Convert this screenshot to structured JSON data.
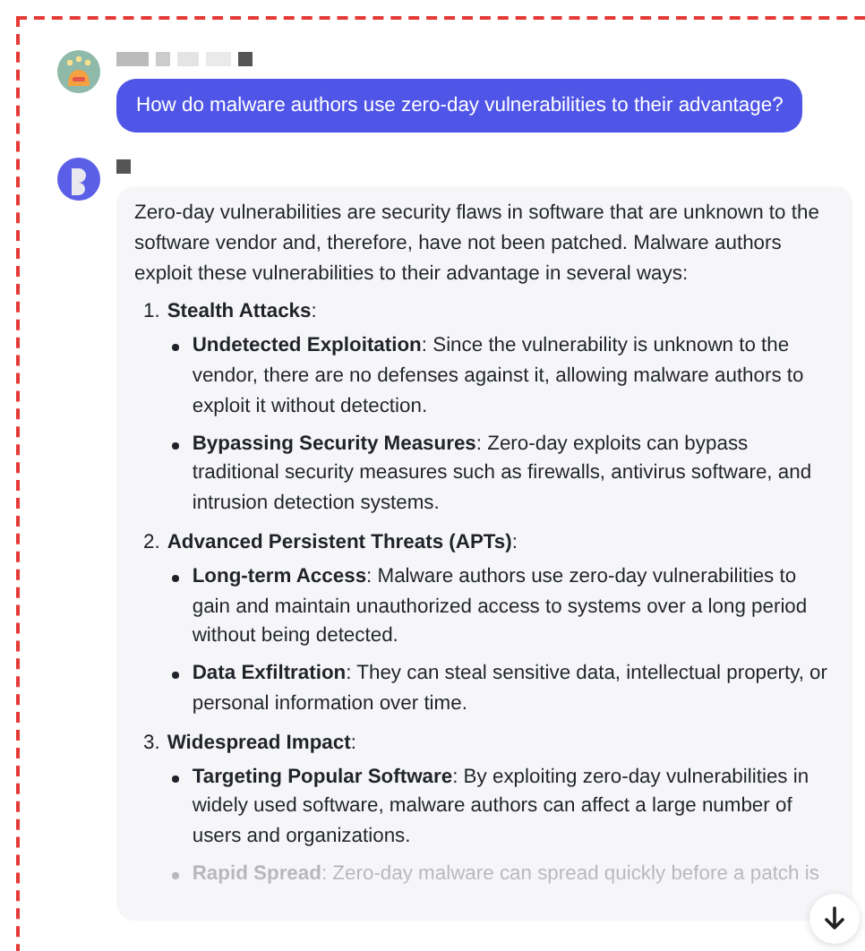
{
  "user_message": {
    "text": "How do malware authors use zero-day vulnerabilities to their advantage?"
  },
  "assistant_message": {
    "intro": "Zero-day vulnerabilities are security flaws in software that are unknown to the software vendor and, therefore, have not been patched. Malware authors exploit these vulnerabilities to their advantage in several ways:",
    "sections": [
      {
        "number": "1.",
        "title": "**Stealth Attacks**:",
        "items": [
          {
            "text": "**Undetected Exploitation**: Since the vulnerability is unknown to the vendor, there are no defenses against it, allowing malware authors to exploit it without detection.",
            "faded": false
          },
          {
            "text": "**Bypassing Security Measures**: Zero-day exploits can bypass traditional security measures such as firewalls, antivirus software, and intrusion detection systems.",
            "faded": false
          }
        ]
      },
      {
        "number": "2.",
        "title": "**Advanced Persistent Threats (APTs)**:",
        "items": [
          {
            "text": "**Long-term Access**: Malware authors use zero-day vulnerabilities to gain and maintain unauthorized access to systems over a long period without being detected.",
            "faded": false
          },
          {
            "text": "**Data Exfiltration**: They can steal sensitive data, intellectual property, or personal information over time.",
            "faded": false
          }
        ]
      },
      {
        "number": "3.",
        "title": "**Widespread Impact**:",
        "items": [
          {
            "text": "**Targeting Popular Software**: By exploiting zero-day vulnerabilities in widely used software, malware authors can affect a large number of users and organizations.",
            "faded": false
          },
          {
            "text": "**Rapid Spread**: Zero-day malware can spread quickly before a patch is",
            "faded": true
          }
        ]
      }
    ]
  }
}
